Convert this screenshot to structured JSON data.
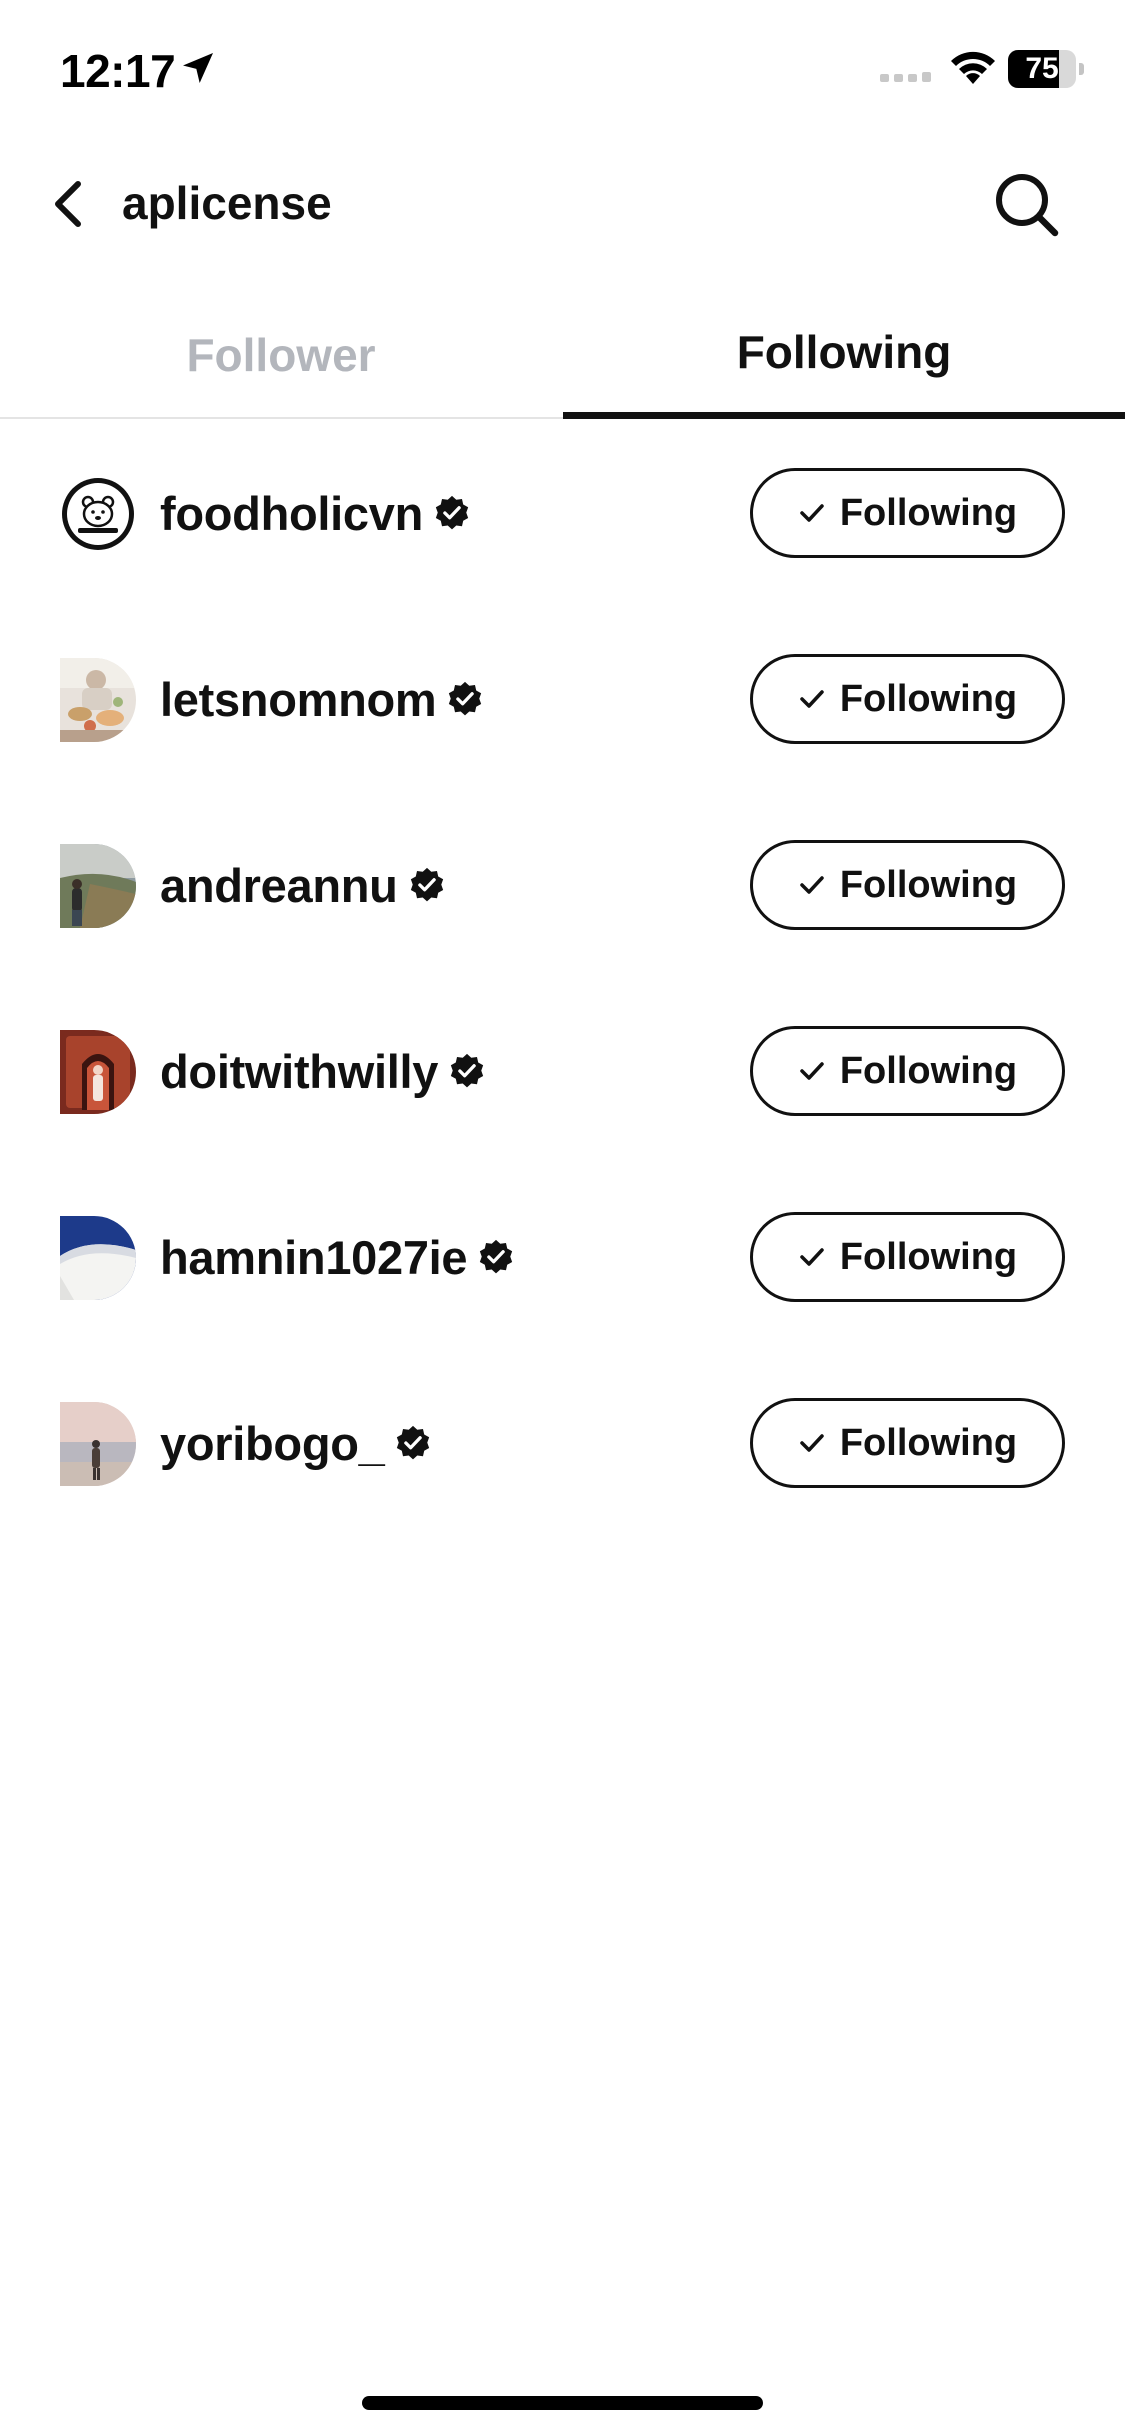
{
  "status_bar": {
    "time": "12:17",
    "battery_level": "75",
    "battery_fraction": 0.75
  },
  "header": {
    "title": "aplicense",
    "back_icon": "chevron-left-icon",
    "search_icon": "search-icon"
  },
  "tabs": [
    {
      "label": "Follower",
      "active": false
    },
    {
      "label": "Following",
      "active": true
    }
  ],
  "following_list": [
    {
      "username": "foodholicvn",
      "verified": true,
      "button_label": "Following"
    },
    {
      "username": "letsnomnom",
      "verified": true,
      "button_label": "Following"
    },
    {
      "username": "andreannu",
      "verified": true,
      "button_label": "Following"
    },
    {
      "username": "doitwithwilly",
      "verified": true,
      "button_label": "Following"
    },
    {
      "username": "hamnin1027ie",
      "verified": true,
      "button_label": "Following"
    },
    {
      "username": "yoribogo_",
      "verified": true,
      "button_label": "Following"
    }
  ],
  "colors": {
    "text": "#111111",
    "inactive_tab": "#b3b6bc",
    "divider": "#e4e4e4",
    "background": "#ffffff"
  }
}
